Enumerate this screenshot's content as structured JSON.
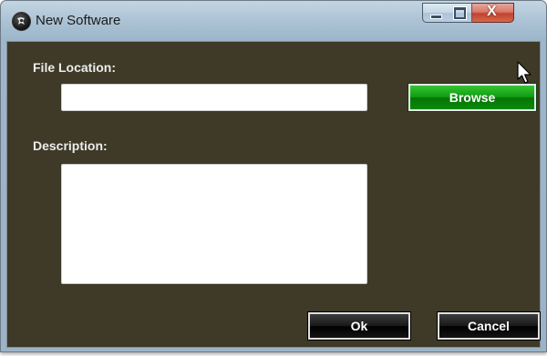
{
  "window": {
    "title": "New Software"
  },
  "form": {
    "file_location_label": "File Location:",
    "file_location_value": "",
    "description_label": "Description:",
    "description_value": ""
  },
  "buttons": {
    "browse": "Browse",
    "ok": "Ok",
    "cancel": "Cancel"
  },
  "titlebar_controls": {
    "minimize_icon": "minimize-icon",
    "maximize_icon": "maximize-icon",
    "close_glyph": "X"
  },
  "colors": {
    "client_background": "#3e3a27",
    "browse_button": "#0f8f0f",
    "dark_button": "#111111"
  }
}
